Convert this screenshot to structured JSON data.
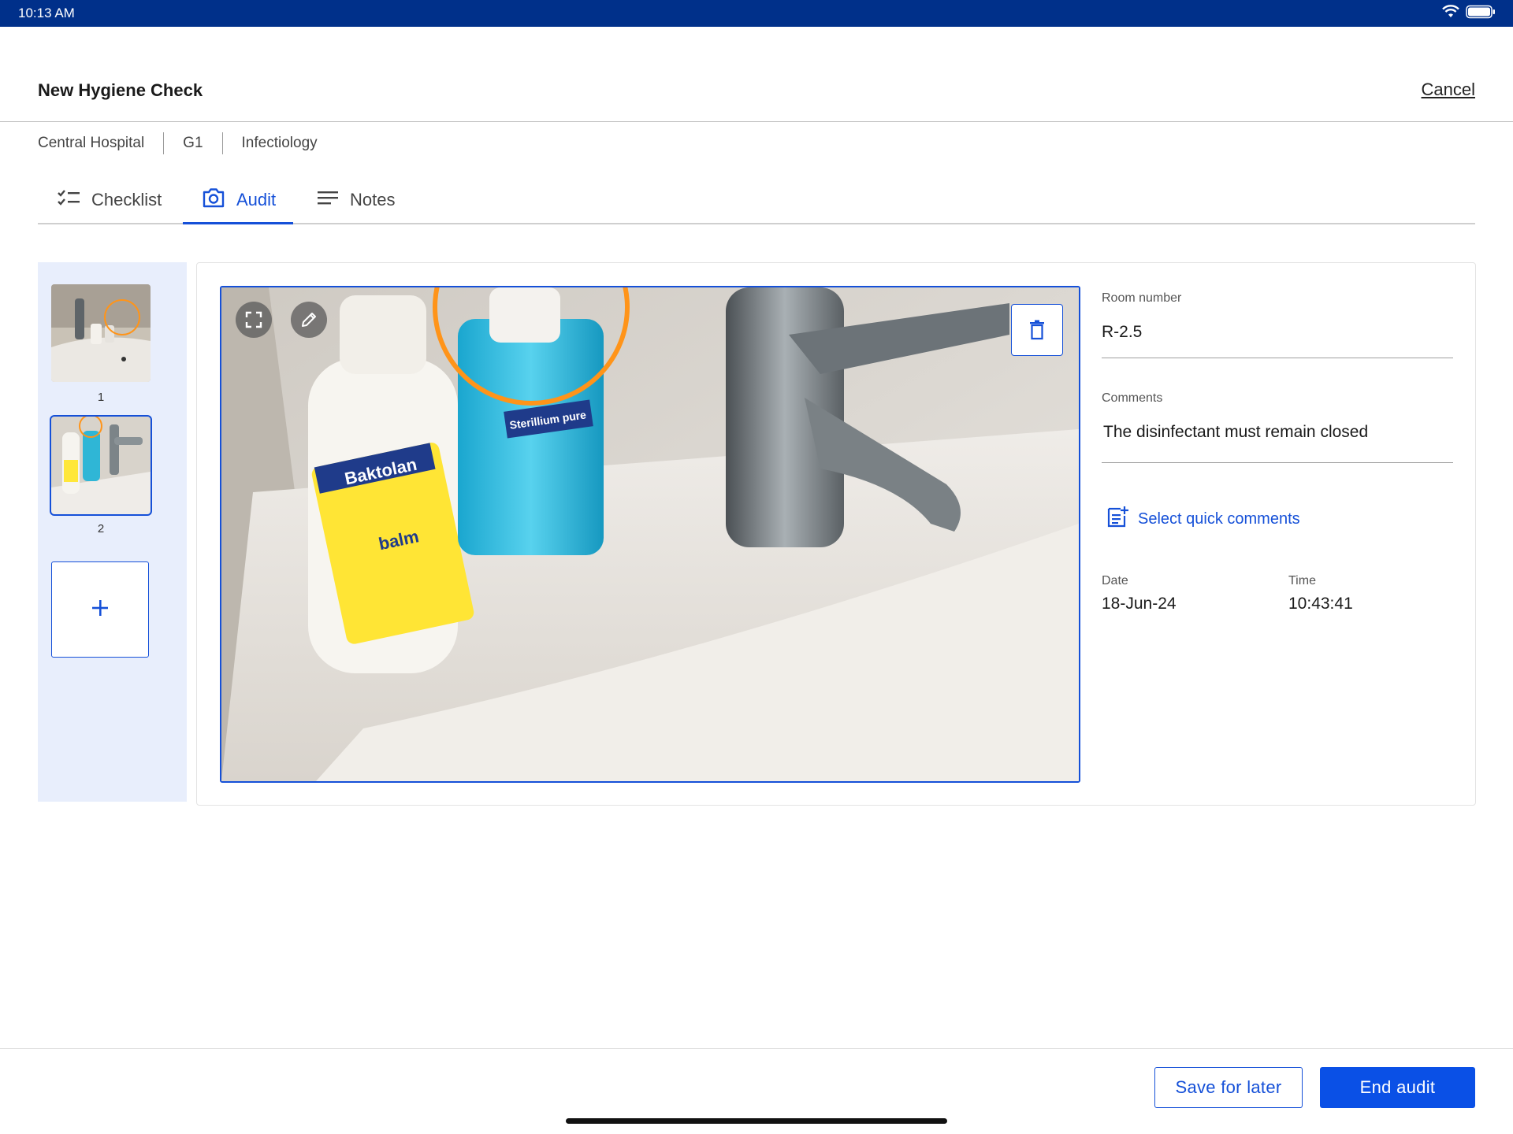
{
  "status_bar": {
    "time": "10:13 AM"
  },
  "header": {
    "title": "New Hygiene Check",
    "cancel_label": "Cancel"
  },
  "breadcrumb": [
    "Central Hospital",
    "G1",
    "Infectiology"
  ],
  "tabs": [
    {
      "label": "Checklist",
      "icon": "checklist-icon",
      "active": false
    },
    {
      "label": "Audit",
      "icon": "camera-icon",
      "active": true
    },
    {
      "label": "Notes",
      "icon": "notes-icon",
      "active": false
    }
  ],
  "thumbnails": [
    {
      "label": "1",
      "selected": false
    },
    {
      "label": "2",
      "selected": true
    }
  ],
  "details": {
    "room_label": "Room number",
    "room_value": "R-2.5",
    "comments_label": "Comments",
    "comments_value": "The disinfectant must remain closed",
    "quick_comments_label": "Select quick comments",
    "date_label": "Date",
    "date_value": "18-Jun-24",
    "time_label": "Time",
    "time_value": "10:43:41"
  },
  "photo_labels": {
    "bottle1_brand": "Baktolan",
    "bottle1_type": "balm",
    "bottle2_brand": "Sterillium pure"
  },
  "footer": {
    "save_label": "Save for later",
    "end_label": "End audit"
  },
  "colors": {
    "accent": "#1550d8",
    "status_bar": "#00308a",
    "annotation": "#ff9419"
  }
}
